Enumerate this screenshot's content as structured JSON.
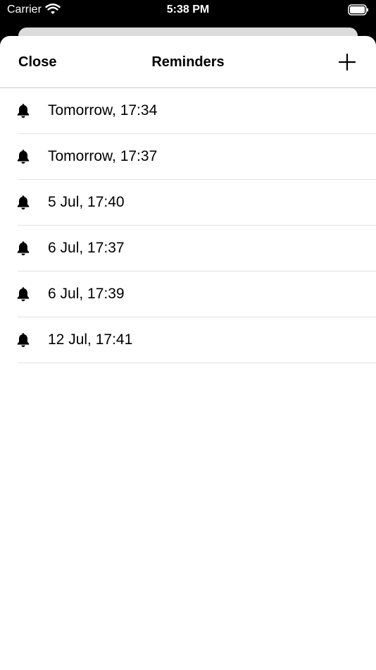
{
  "status": {
    "carrier": "Carrier",
    "time": "5:38 PM",
    "wifi_icon": "wifi-icon",
    "battery_icon": "battery-icon"
  },
  "nav": {
    "close_label": "Close",
    "title": "Reminders",
    "add_icon": "plus-icon"
  },
  "reminders": [
    {
      "icon": "bell-icon",
      "label": "Tomorrow, 17:34"
    },
    {
      "icon": "bell-icon",
      "label": "Tomorrow, 17:37"
    },
    {
      "icon": "bell-icon",
      "label": "5 Jul, 17:40"
    },
    {
      "icon": "bell-icon",
      "label": "6 Jul, 17:37"
    },
    {
      "icon": "bell-icon",
      "label": "6 Jul, 17:39"
    },
    {
      "icon": "bell-icon",
      "label": "12 Jul, 17:41"
    }
  ]
}
